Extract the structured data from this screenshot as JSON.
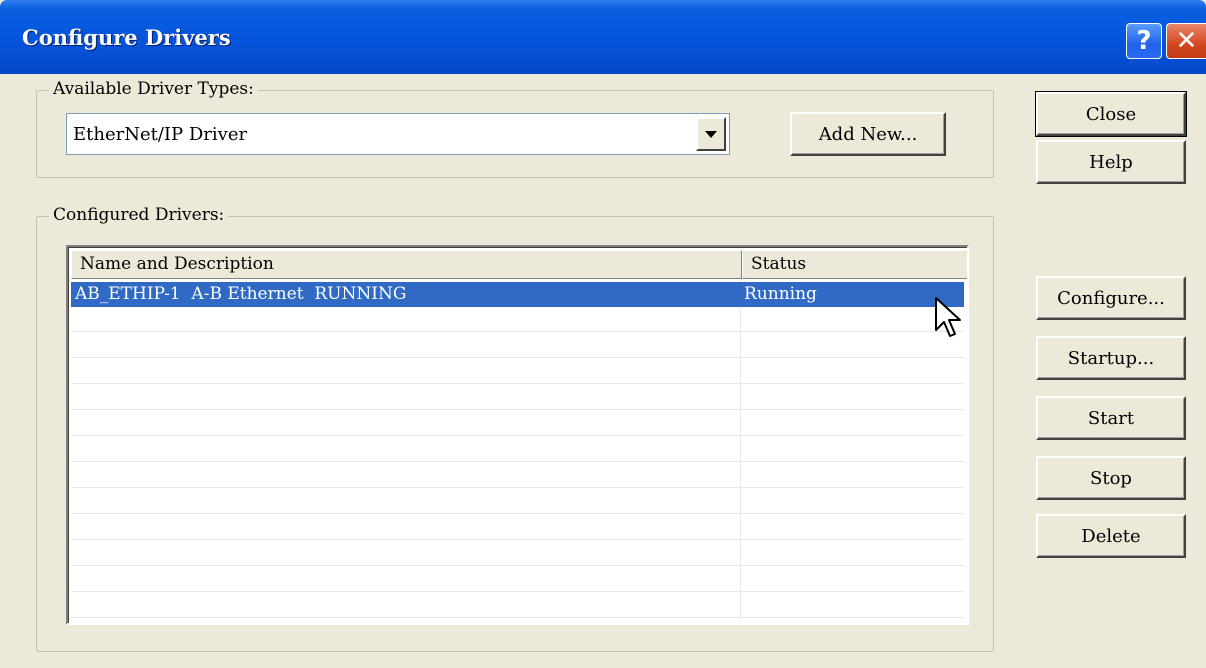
{
  "window": {
    "title": "Configure Drivers"
  },
  "titlebar_buttons": {
    "help": "?",
    "close": "✕"
  },
  "available": {
    "legend": "Available Driver Types:",
    "selected": "EtherNet/IP Driver",
    "add_new": "Add New..."
  },
  "configured": {
    "legend": "Configured Drivers:",
    "columns": [
      "Name and Description",
      "Status"
    ],
    "rows": [
      {
        "name": "AB_ETHIP-1  A-B Ethernet  RUNNING",
        "status": "Running",
        "selected": true
      }
    ]
  },
  "buttons": {
    "close": "Close",
    "help": "Help",
    "configure": "Configure...",
    "startup": "Startup...",
    "start": "Start",
    "stop": "Stop",
    "delete": "Delete"
  },
  "colors": {
    "titlebar": "#0554dc",
    "selection": "#316ac5",
    "dialog": "#ece9d8"
  }
}
